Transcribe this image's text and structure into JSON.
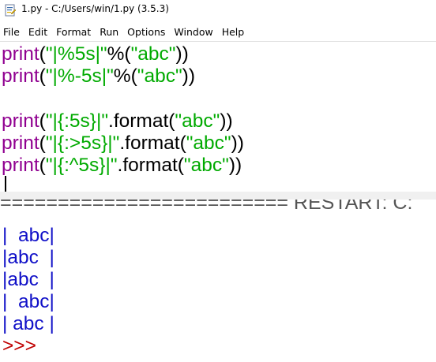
{
  "window": {
    "title": "1.py - C:/Users/win/1.py (3.5.3)"
  },
  "menu": {
    "items": [
      "File",
      "Edit",
      "Format",
      "Run",
      "Options",
      "Window",
      "Help"
    ]
  },
  "editor": {
    "lines": [
      {
        "kw": "print",
        "open": "(",
        "str": "\"|%5s|\"",
        "rest1": "%(",
        "arg": "\"abc\"",
        "rest2": "))"
      },
      {
        "kw": "print",
        "open": "(",
        "str": "\"|%-5s|\"",
        "rest1": "%(",
        "arg": "\"abc\"",
        "rest2": "))"
      },
      {
        "kw": "print",
        "open": "(",
        "str": "\"|{:5s}|\"",
        "rest1": ".format(",
        "arg": "\"abc\"",
        "rest2": "))"
      },
      {
        "kw": "print",
        "open": "(",
        "str": "\"|{:>5s}|\"",
        "rest1": ".format(",
        "arg": "\"abc\"",
        "rest2": "))"
      },
      {
        "kw": "print",
        "open": "(",
        "str": "\"|{:^5s}|\"",
        "rest1": ".format(",
        "arg": "\"abc\"",
        "rest2": "))"
      }
    ]
  },
  "shell": {
    "restart": "========================= RESTART: C:",
    "output": [
      "|  abc|",
      "|abc  |",
      "|abc  |",
      "|  abc|",
      "| abc |"
    ],
    "prompt": ">>>"
  },
  "colors": {
    "keyword": "#900090",
    "string": "#00aa00",
    "output": "#1010c8",
    "prompt": "#c00000"
  }
}
